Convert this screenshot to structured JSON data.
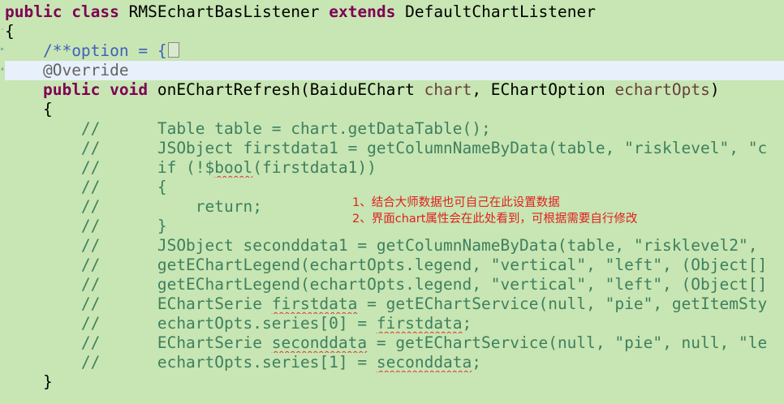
{
  "code": {
    "l1": {
      "kw1": "public",
      "kw2": "class",
      "name": "RMSEchartBasListener",
      "kw3": "extends",
      "parent": "DefaultChartListener"
    },
    "l2": "{",
    "l3": "/**option = {",
    "l4": "@Override",
    "l5": {
      "kw1": "public",
      "kw2": "void",
      "method": "onEChartRefresh(BaiduEChart ",
      "p1": "chart",
      ", EChartOption ": ", EChartOption ",
      "p2": "echartOpts",
      "close": ")"
    },
    "l6": "{",
    "c1": "//      Table table = chart.getDataTable();",
    "c2": "//      JSObject firstdata1 = getColumnNameByData(table, \"risklevel\", \"c",
    "c3a": "//      if (!$",
    "c3b": "bool",
    "c3c": "(firstdata1))",
    "c4": "//      {",
    "c5": "//          return;",
    "c6": "//      }",
    "c7": "//      JSObject seconddata1 = getColumnNameByData(table, \"risklevel2\",",
    "c8": "//      getEChartLegend(echartOpts.legend, \"vertical\", \"left\", (Object[]",
    "c9": "//      getEChartLegend(echartOpts.legend, \"vertical\", \"left\", (Object[]",
    "c10a": "//      EChartSerie ",
    "c10b": "firstdata",
    "c10c": " = getEChartService(null, \"pie\", getItemSty",
    "c11a": "//      echartOpts.series[0] = ",
    "c11b": "firstdata",
    "c11c": ";",
    "c12a": "//      EChartSerie ",
    "c12b": "seconddata",
    "c12c": " = getEChartService(null, \"pie\", null, \"le",
    "c13a": "//      echartOpts.series[1] = ",
    "c13b": "seconddata",
    "c13c": ";",
    "l20": "}"
  },
  "notes": {
    "n1": "1、结合大师数据也可自己在此设置数据",
    "n2": "2、界面chart属性会在此处看到，可根据需要自行修改"
  },
  "colors": {
    "background": "#c7e6b3",
    "keyword": "#7f0055",
    "comment": "#3f7f5f",
    "javadoc": "#3f5fbf",
    "annotation_note": "#e02020",
    "current_line": "#e7f0fb"
  }
}
